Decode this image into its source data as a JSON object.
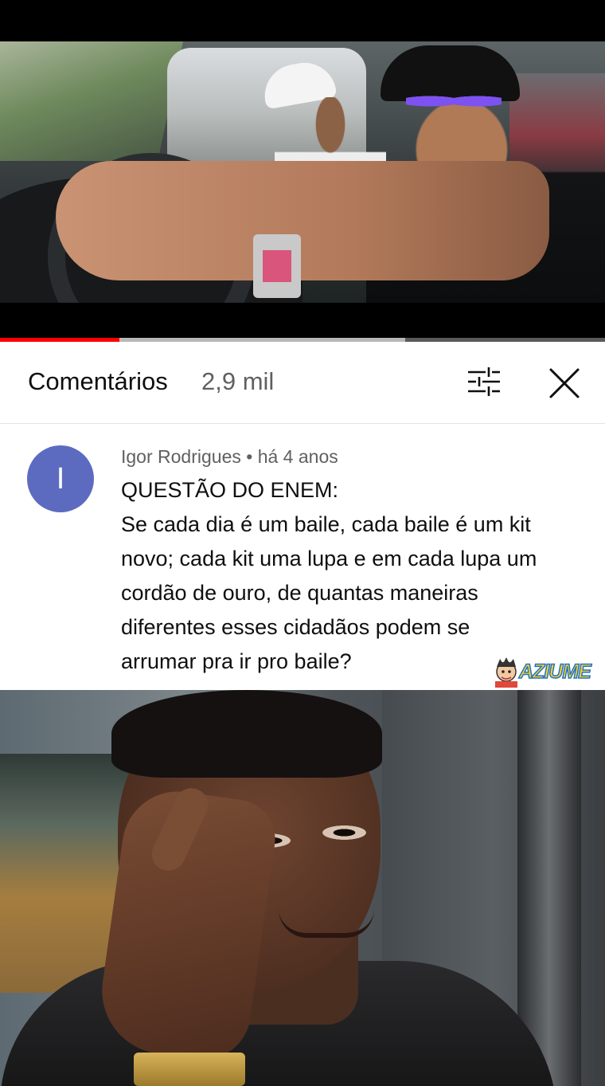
{
  "video": {
    "progress_percent": 19.7,
    "buffered_percent": 67
  },
  "comments_header": {
    "title": "Comentários",
    "count": "2,9 mil",
    "icons": [
      "filter-sort-icon",
      "close-icon"
    ]
  },
  "comment": {
    "avatar_letter": "I",
    "avatar_color": "#5c6bc0",
    "author": "Igor Rodrigues",
    "separator": "•",
    "time": "há 4 anos",
    "lines": [
      "QUESTÃO DO ENEM:",
      "Se cada dia é um baile, cada baile é um kit",
      "novo; cada kit uma lupa e em cada lupa um",
      "cordão de ouro, de quantas maneiras",
      "diferentes esses cidadãos podem se",
      "arrumar pra ir pro baile?"
    ]
  },
  "watermark": {
    "text": "AZIUME"
  },
  "colors": {
    "accent_red": "#ff0000",
    "text_primary": "#0f0f0f",
    "text_secondary": "#606060"
  }
}
